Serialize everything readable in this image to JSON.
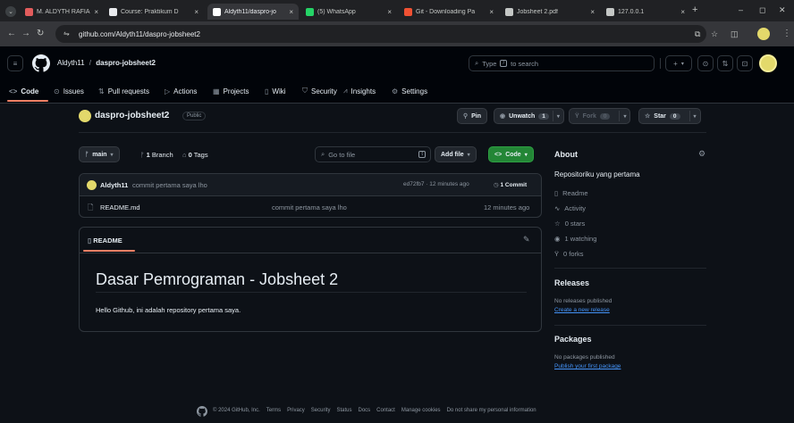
{
  "browser": {
    "tabs": [
      {
        "title": "M. ALDYTH RAFIAND",
        "favicon_color": "#e25c5c"
      },
      {
        "title": "Course: Praktikum D",
        "favicon_color": "#e8eaed"
      },
      {
        "title": "Aldyth11/daspro-jo",
        "favicon_color": "#ffffff"
      },
      {
        "title": "(5) WhatsApp",
        "favicon_color": "#25d366"
      },
      {
        "title": "Git - Downloading Pa",
        "favicon_color": "#f05133"
      },
      {
        "title": "Jobsheet 2.pdf",
        "favicon_color": "#c4c7c5"
      },
      {
        "title": "127.0.0.1",
        "favicon_color": "#c4c7c5"
      }
    ],
    "new_tab": "+",
    "close_glyph": "×",
    "url": "github.com/Aldyth11/daspro-jobsheet2",
    "window": {
      "minimize": "–",
      "maximize": "◻",
      "close": "✕"
    }
  },
  "header": {
    "owner": "Aldyth11",
    "slash": "/",
    "repo": "daspro-jobsheet2",
    "search_placeholder_pre": "Type",
    "search_key": "/",
    "search_placeholder_post": "to search",
    "plus": "+"
  },
  "nav": {
    "tabs": [
      {
        "label": "Code",
        "icon": "<>"
      },
      {
        "label": "Issues",
        "icon": "⊙"
      },
      {
        "label": "Pull requests",
        "icon": "⇅"
      },
      {
        "label": "Actions",
        "icon": "▷"
      },
      {
        "label": "Projects",
        "icon": "▦"
      },
      {
        "label": "Wiki",
        "icon": "▯"
      },
      {
        "label": "Security",
        "icon": "⛉"
      },
      {
        "label": "Insights",
        "icon": "⩘"
      },
      {
        "label": "Settings",
        "icon": "⚙"
      }
    ]
  },
  "repo": {
    "name": "daspro-jobsheet2",
    "visibility": "Public",
    "pin": "Pin",
    "unwatch": "Unwatch",
    "watch_count": "1",
    "fork": "Fork",
    "fork_count": "0",
    "star": "Star",
    "star_count": "0"
  },
  "toolbar": {
    "branch": "main",
    "branch_count": "1",
    "branch_word": "Branch",
    "tag_count": "0",
    "tag_word": "Tags",
    "go_to_file": "Go to file",
    "go_key": "t",
    "add_file": "Add file",
    "code": "Code"
  },
  "commit": {
    "author": "Aldyth11",
    "message": "commit pertama saya lho",
    "hash": "ed72fb7",
    "sep": "·",
    "time": "12 minutes ago",
    "count": "1",
    "count_word": "Commit"
  },
  "files": [
    {
      "name": "README.md",
      "message": "commit pertama saya lho",
      "time": "12 minutes ago"
    }
  ],
  "readme": {
    "tab": "README",
    "heading": "Dasar Pemrograman - Jobsheet 2",
    "body": "Hello Github, ini adalah repository pertama saya."
  },
  "about": {
    "title": "About",
    "description": "Repositoriku yang pertama",
    "items": [
      {
        "icon": "book-icon",
        "glyph": "▯",
        "label": "Readme"
      },
      {
        "icon": "pulse-icon",
        "glyph": "∿",
        "label": "Activity"
      },
      {
        "icon": "star-icon",
        "glyph": "☆",
        "label": "0 stars"
      },
      {
        "icon": "eye-icon",
        "glyph": "◉",
        "label": "1 watching"
      },
      {
        "icon": "fork-icon",
        "glyph": "Ÿ",
        "label": "0 forks"
      }
    ]
  },
  "releases": {
    "title": "Releases",
    "empty": "No releases published",
    "create_link": "Create a new release"
  },
  "packages": {
    "title": "Packages",
    "empty": "No packages published",
    "publish_link": "Publish your first package"
  },
  "footer": {
    "copyright": "© 2024 GitHub, Inc.",
    "links": [
      "Terms",
      "Privacy",
      "Security",
      "Status",
      "Docs",
      "Contact",
      "Manage cookies",
      "Do not share my personal information"
    ]
  },
  "colors": {
    "accent_green": "#238636",
    "link_blue": "#4493f8",
    "nav_underline": "#f78166",
    "avatar_yellow": "#e3d96b"
  }
}
